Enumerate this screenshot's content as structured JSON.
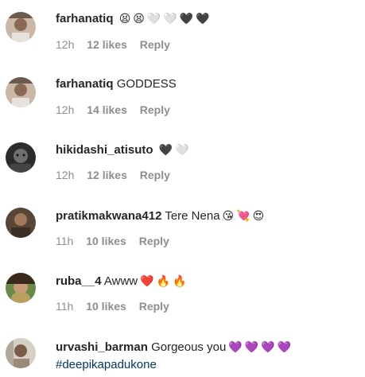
{
  "comments": [
    {
      "username": "farhanatiq",
      "text": "",
      "emojis": [
        "😫",
        "😫",
        "🤍",
        "🤍",
        "🖤",
        "🖤"
      ],
      "time": "12h",
      "likes": "12 likes",
      "reply": "Reply"
    },
    {
      "username": "farhanatiq",
      "text": "GODDESS",
      "emojis": [],
      "time": "12h",
      "likes": "14 likes",
      "reply": "Reply"
    },
    {
      "username": "hikidashi_atisuto",
      "text": "",
      "emojis": [
        "🖤",
        "🤍"
      ],
      "time": "12h",
      "likes": "12 likes",
      "reply": "Reply"
    },
    {
      "username": "pratikmakwana412",
      "text": "Tere Nena",
      "emojis": [
        "😘",
        "💘",
        "😍"
      ],
      "time": "11h",
      "likes": "10 likes",
      "reply": "Reply"
    },
    {
      "username": "ruba__4",
      "text": "Awww",
      "emojis": [
        "❤️",
        "🔥",
        "🔥"
      ],
      "time": "11h",
      "likes": "10 likes",
      "reply": "Reply"
    },
    {
      "username": "urvashi_barman",
      "text": "Gorgeous you",
      "emojis": [
        "💜",
        "💜",
        "💜",
        "💜"
      ],
      "hashtag": "#deepikapadukone"
    }
  ]
}
